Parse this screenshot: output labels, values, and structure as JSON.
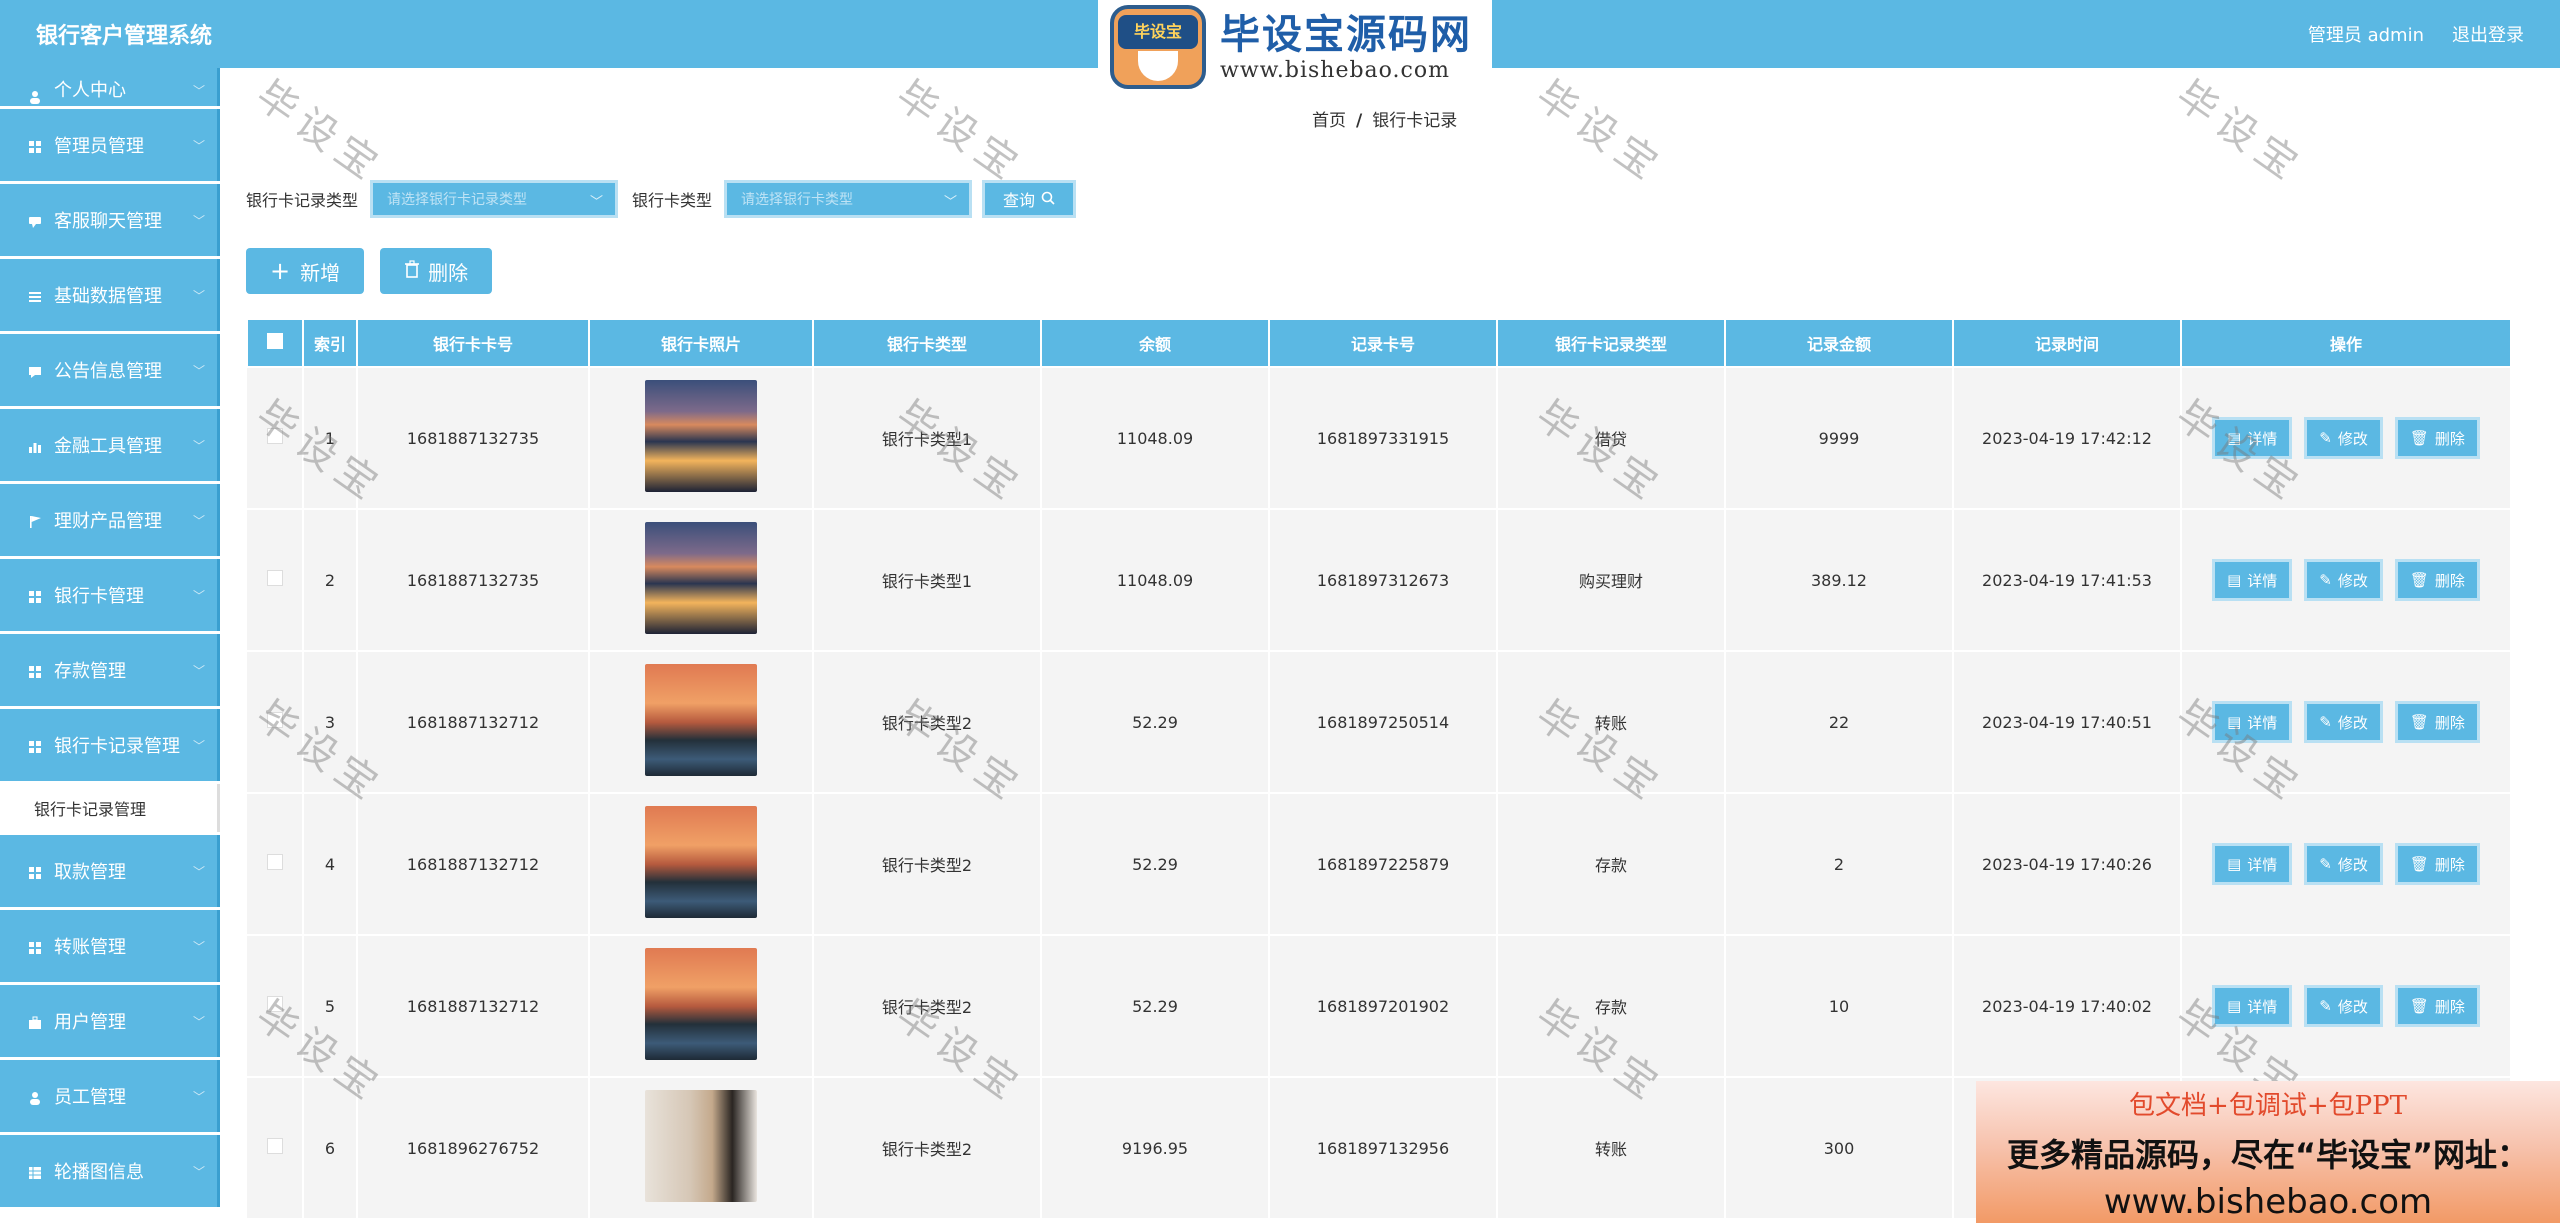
{
  "header": {
    "app_title": "银行客户管理系统",
    "admin_label": "管理员 admin",
    "logout": "退出登录"
  },
  "brand": {
    "logo_text": "毕设宝",
    "name": "毕设宝源码网",
    "url": "www.bishebao.com"
  },
  "sidebar": {
    "top_partial": "个人中心",
    "items": [
      {
        "label": "管理员管理",
        "icon": "grid-icon"
      },
      {
        "label": "客服聊天管理",
        "icon": "chat-icon"
      },
      {
        "label": "基础数据管理",
        "icon": "list-icon"
      },
      {
        "label": "公告信息管理",
        "icon": "message-icon"
      },
      {
        "label": "金融工具管理",
        "icon": "bar-chart-icon"
      },
      {
        "label": "理财产品管理",
        "icon": "flag-icon"
      },
      {
        "label": "银行卡管理",
        "icon": "grid-icon"
      },
      {
        "label": "存款管理",
        "icon": "grid-icon"
      },
      {
        "label": "银行卡记录管理",
        "icon": "grid-icon"
      }
    ],
    "active_sub": "银行卡记录管理",
    "items_after": [
      {
        "label": "取款管理",
        "icon": "grid-icon"
      },
      {
        "label": "转账管理",
        "icon": "grid-icon"
      },
      {
        "label": "用户管理",
        "icon": "briefcase-icon"
      },
      {
        "label": "员工管理",
        "icon": "user-icon"
      },
      {
        "label": "轮播图信息",
        "icon": "table-icon"
      }
    ]
  },
  "breadcrumb": {
    "home": "首页",
    "current": "银行卡记录"
  },
  "search": {
    "record_type_label": "银行卡记录类型",
    "record_type_placeholder": "请选择银行卡记录类型",
    "card_type_label": "银行卡类型",
    "card_type_placeholder": "请选择银行卡类型",
    "query_label": "查询"
  },
  "actions": {
    "add_label": "新增",
    "delete_label": "删除"
  },
  "table": {
    "headers": [
      "索引",
      "银行卡卡号",
      "银行卡照片",
      "银行卡类型",
      "余额",
      "记录卡号",
      "银行卡记录类型",
      "记录金额",
      "记录时间",
      "操作"
    ],
    "op_labels": {
      "detail": "详情",
      "edit": "修改",
      "delete": "删除"
    },
    "rows": [
      {
        "index": "1",
        "card_no": "1681887132735",
        "photo": "mountain",
        "card_type": "银行卡类型1",
        "balance": "11048.09",
        "record_no": "1681897331915",
        "record_type": "借贷",
        "amount": "9999",
        "time": "2023-04-19 17:42:12"
      },
      {
        "index": "2",
        "card_no": "1681887132735",
        "photo": "mountain",
        "card_type": "银行卡类型1",
        "balance": "11048.09",
        "record_no": "1681897312673",
        "record_type": "购买理财",
        "amount": "389.12",
        "time": "2023-04-19 17:41:53"
      },
      {
        "index": "3",
        "card_no": "1681887132712",
        "photo": "sunset",
        "card_type": "银行卡类型2",
        "balance": "52.29",
        "record_no": "1681897250514",
        "record_type": "转账",
        "amount": "22",
        "time": "2023-04-19 17:40:51"
      },
      {
        "index": "4",
        "card_no": "1681887132712",
        "photo": "sunset",
        "card_type": "银行卡类型2",
        "balance": "52.29",
        "record_no": "1681897225879",
        "record_type": "存款",
        "amount": "2",
        "time": "2023-04-19 17:40:26"
      },
      {
        "index": "5",
        "card_no": "1681887132712",
        "photo": "sunset",
        "card_type": "银行卡类型2",
        "balance": "52.29",
        "record_no": "1681897201902",
        "record_type": "存款",
        "amount": "10",
        "time": "2023-04-19 17:40:02"
      },
      {
        "index": "6",
        "card_no": "1681896276752",
        "photo": "portrait",
        "card_type": "银行卡类型2",
        "balance": "9196.95",
        "record_no": "1681897132956",
        "record_type": "转账",
        "amount": "300",
        "time": ""
      }
    ]
  },
  "watermark_text": "毕设宝",
  "promo": {
    "line1": "包文档+包调试+包PPT",
    "line2": "更多精品源码，尽在“毕设宝”网址：",
    "line3": "www.bishebao.com"
  },
  "colors": {
    "primary": "#5bb8e3",
    "promo_red": "#e24a2c"
  }
}
